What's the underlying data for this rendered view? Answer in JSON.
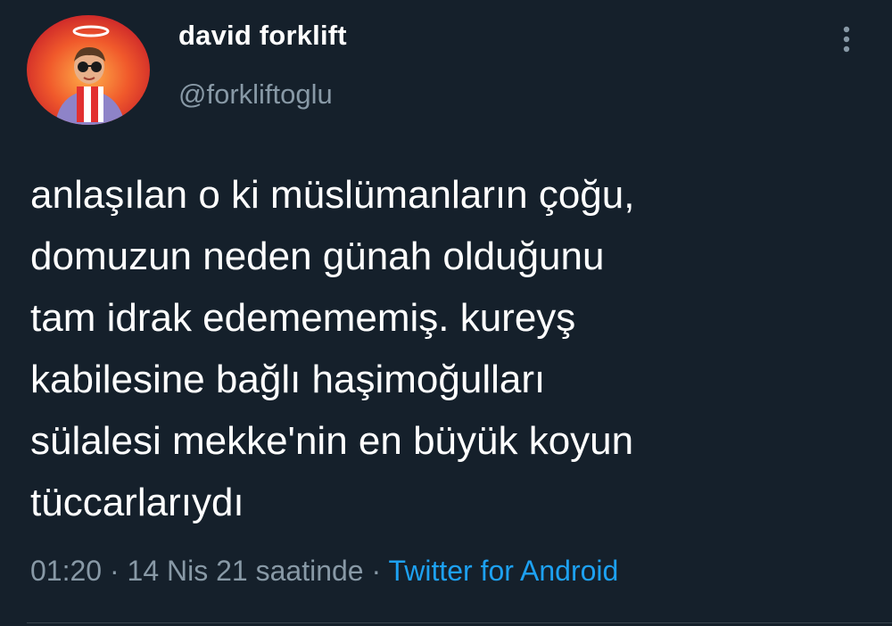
{
  "user": {
    "display_name": "david forklift",
    "handle": "@forkliftoglu"
  },
  "tweet": {
    "text": "anlaşılan o ki müslümanların çoğu,\ndomuzun neden günah olduğunu\ntam idrak edemememiş. kureyş\nkabilesine bağlı haşimoğulları\nsülalesi mekke'nin en büyük koyun\ntüccarlarıydı",
    "time": "01:20",
    "separator": " · ",
    "date": "14 Nis 21 saatinde",
    "source": "Twitter for Android"
  },
  "icons": {
    "avatar": "avatar-image",
    "more": "more-vertical-icon"
  },
  "colors": {
    "background": "#15202b",
    "text": "#ffffff",
    "secondary_text": "#8899a6",
    "link": "#1da1f2",
    "divider": "#38444d"
  }
}
